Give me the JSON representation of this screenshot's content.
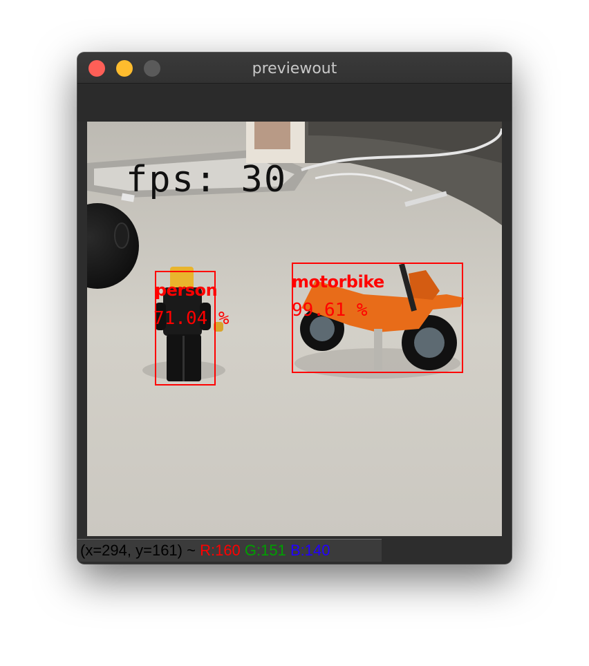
{
  "window": {
    "title": "previewout",
    "buttons": [
      "close",
      "minimize",
      "zoom"
    ]
  },
  "overlay": {
    "fps_text": "fps: 30"
  },
  "detections": [
    {
      "label": "person",
      "confidence": "71.04 %"
    },
    {
      "label": "motorbike",
      "confidence": "99.61 %"
    }
  ],
  "statusbar": {
    "coords": "(x=294, y=161) ~",
    "r": "R:160",
    "g": "G:151",
    "b": "B:140"
  },
  "colors": {
    "bbox": "#ff0000",
    "close": "#fe5f57",
    "minimize": "#febc2e",
    "zoom": "#5a5a5a"
  }
}
